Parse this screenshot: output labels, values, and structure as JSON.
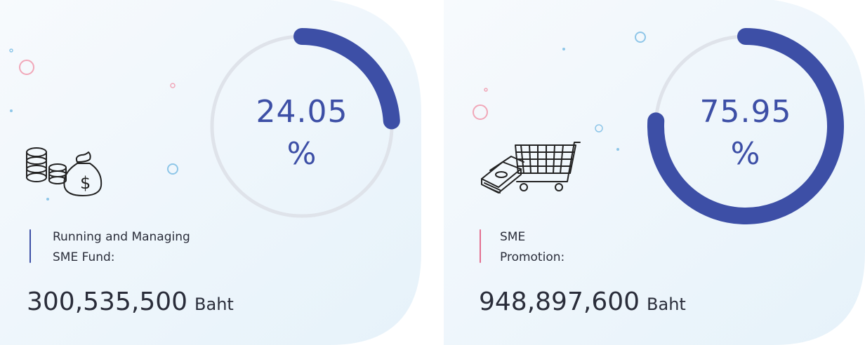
{
  "cards": [
    {
      "percent_value": "24.05",
      "percent_sign": "%",
      "percent_fraction": 0.2405,
      "label_line1": "Running and Managing",
      "label_line2": "SME Fund:",
      "amount": "300,535,500",
      "unit": "Baht",
      "accent_color": "#3d4fa6",
      "label_bar_color": "#3d4fa6",
      "illustration": "money-bags-coins-icon"
    },
    {
      "percent_value": "75.95",
      "percent_sign": "%",
      "percent_fraction": 0.7595,
      "label_line1": "SME",
      "label_line2": "Promotion:",
      "amount": "948,897,600",
      "unit": "Baht",
      "accent_color": "#3d4fa6",
      "label_bar_color": "#e36f8f",
      "illustration": "shopping-cart-money-icon"
    }
  ]
}
